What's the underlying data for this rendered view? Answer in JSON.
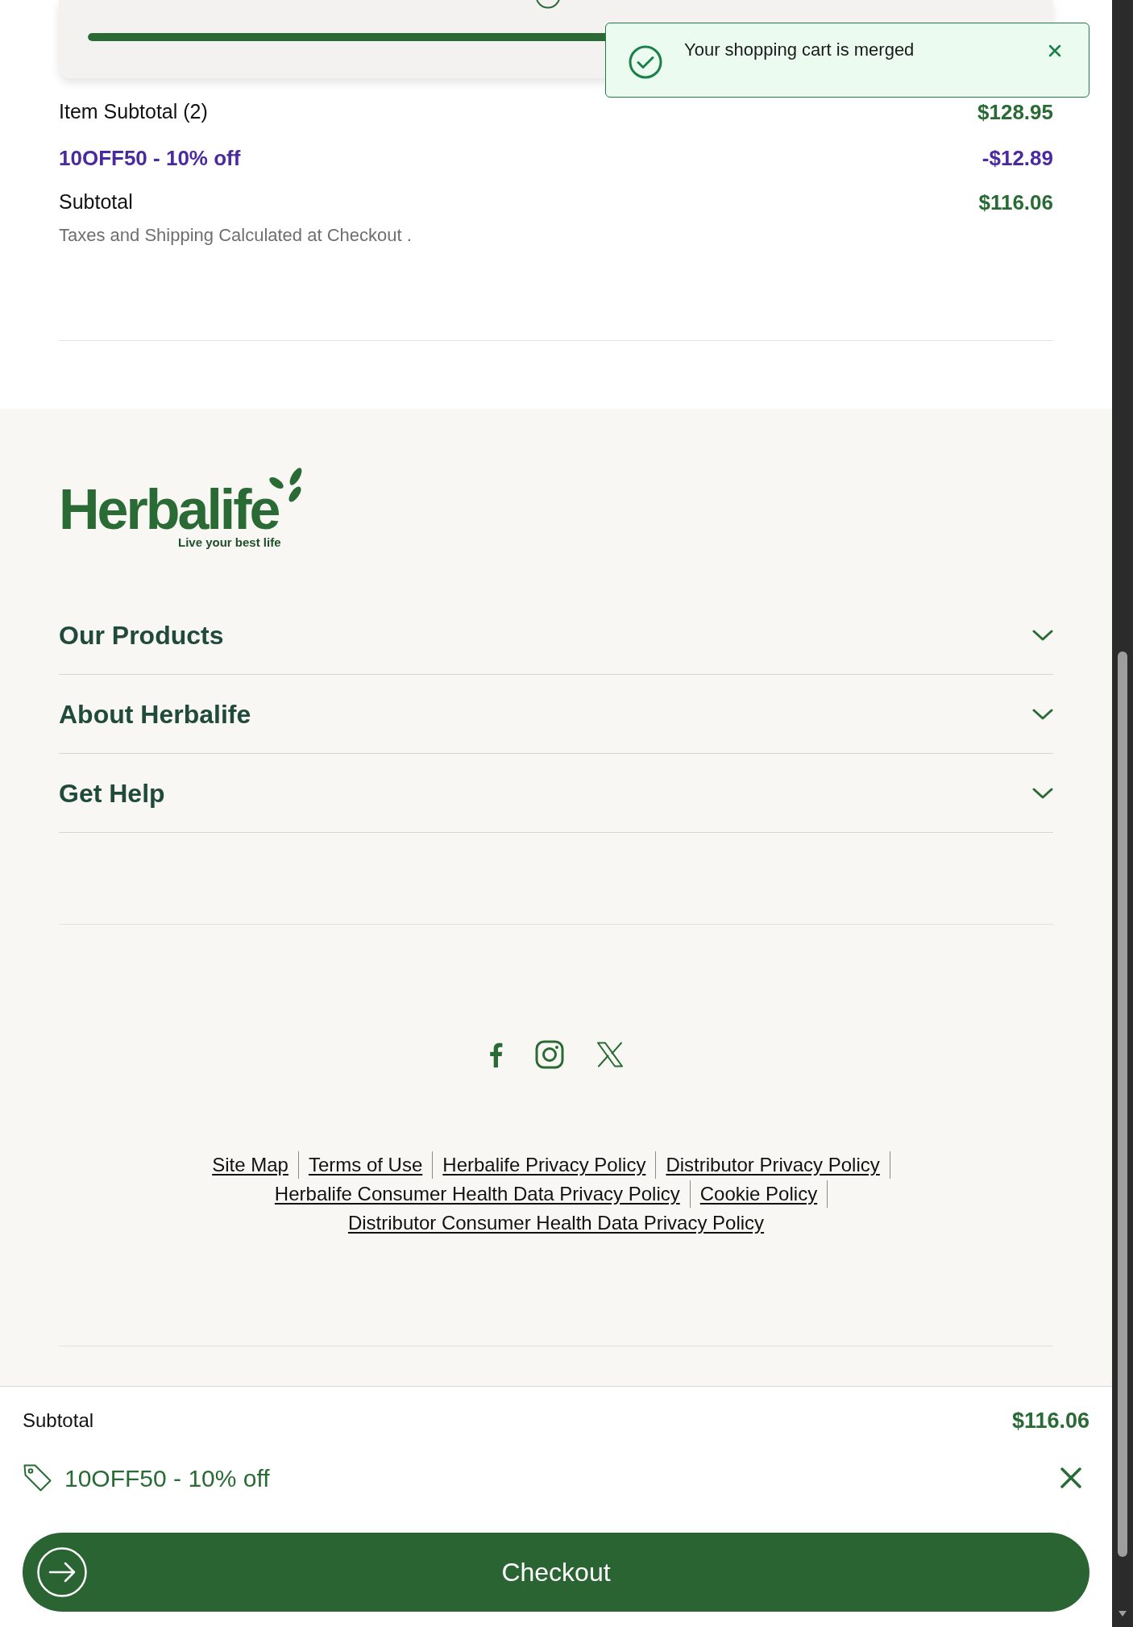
{
  "shipping_progress": {
    "level": 1
  },
  "toast": {
    "message": "Your shopping cart is merged"
  },
  "order_summary": {
    "rows": [
      {
        "kind": "item",
        "label": "Item Subtotal (2)",
        "value": "$128.95"
      },
      {
        "kind": "discount",
        "label": "10OFF50 - 10% off",
        "value": "-$12.89"
      },
      {
        "kind": "total",
        "label": "Subtotal",
        "value": "$116.06"
      }
    ],
    "note": "Taxes and Shipping Calculated at Checkout ."
  },
  "footer": {
    "logo": {
      "wordmark": "Herbalife",
      "tagline": "Live your best life"
    },
    "accordion": [
      {
        "label": "Our Products",
        "expanded": false
      },
      {
        "label": "About Herbalife",
        "expanded": false
      },
      {
        "label": "Get Help",
        "expanded": false
      }
    ],
    "link_lines": [
      [
        "Site Map",
        "Terms of Use",
        "Herbalife Privacy Policy",
        "Distributor Privacy Policy"
      ],
      [
        "Herbalife Consumer Health Data Privacy Policy",
        "Cookie Policy"
      ],
      [
        "Distributor Consumer Health Data Privacy Policy"
      ]
    ]
  },
  "checkout_bar": {
    "subtotal_label": "Subtotal",
    "subtotal_value": "$116.06",
    "promo_code": "10OFF50 - 10% off",
    "button": "Checkout"
  }
}
